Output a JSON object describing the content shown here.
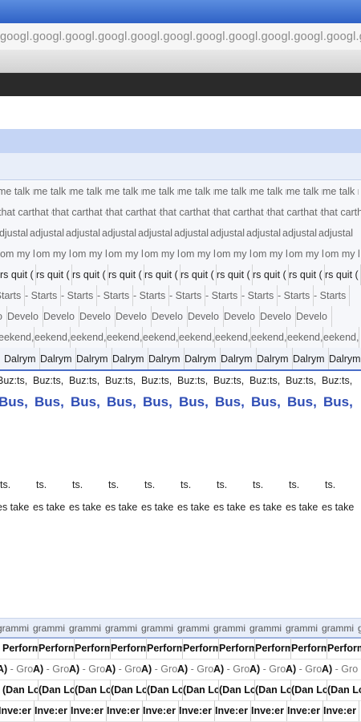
{
  "browser": {
    "address_text": "googl.googl.googl.googl.googl.googl.googl.googl.googl.googl.googl.googl.googl.googl.googl"
  },
  "rows": {
    "talk": "me talk m",
    "that": "that carthat car",
    "adjustal": "adjustal",
    "mylom": "om my l",
    "rsquit": "rs quit (",
    "starts": "- Starts",
    "develo": "Develo",
    "eekend": "eekend,",
    "dalrym": "Dalrym",
    "buzts": "Buz:ts,",
    "bus": "Bus,",
    "ts": "ts.",
    "take": "es take",
    "grammi": "grammi",
    "perfor": "Perform",
    "groa_bold": "A)",
    "groa_gray": " - Gro",
    "dan": "(Dan Lc",
    "inve": "Inve:er"
  },
  "colors": {
    "title_bar": "#2f62c6",
    "section_header": "#c5d5f5",
    "section_sub": "#e8eef9",
    "link_blue": "#2f4db5"
  }
}
